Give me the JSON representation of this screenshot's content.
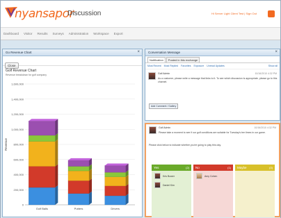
{
  "header": {
    "logo_text": "nyansapor",
    "app_title": "Discussion",
    "user_info": "Hi Server Light Client Test | Sign Out"
  },
  "nav": {
    "items": [
      "Dashboard",
      "Visitor",
      "Results",
      "Surveys",
      "Administration",
      "Workspace",
      "Export"
    ]
  },
  "left_panel": {
    "title": "Go Revenue Chart",
    "close_icon": "close-icon",
    "toolbar_button": "Close",
    "chart_title": "Golf Revenue Chart",
    "chart_subtitle": "Revenue breakdown for golf company"
  },
  "chart_data": {
    "type": "bar",
    "categories": [
      "Golf Balls",
      "Putters",
      "Drivers"
    ],
    "ylabel": "Revenue",
    "ylim": [
      0,
      1600000
    ],
    "yticks": [
      "1,600,000",
      "1,400,000",
      "1,200,000",
      "1,000,000",
      "800,000",
      "600,000",
      "400,000",
      "200,000",
      "0"
    ],
    "stacked": true,
    "series": [
      {
        "color": "#3b8fe0",
        "values": [
          230000,
          150000,
          120000
        ]
      },
      {
        "color": "#d23a2a",
        "values": [
          280000,
          170000,
          130000
        ]
      },
      {
        "color": "#f2b21c",
        "values": [
          330000,
          130000,
          120000
        ]
      },
      {
        "color": "#8ac83a",
        "values": [
          80000,
          60000,
          60000
        ]
      },
      {
        "color": "#9b4fb0",
        "values": [
          190000,
          80000,
          90000
        ]
      }
    ]
  },
  "right_top": {
    "title": "Conversation Message",
    "tabs": [
      "Notification",
      "Posted in this exchange"
    ],
    "subtabs": [
      "Most Recent",
      "Most Replied",
      "Favorites",
      "Exposure",
      "Unread Updates"
    ],
    "subtab_right": "Show all",
    "post_user": "Golf Admin",
    "post_time": "10/16/2010 4:32 PM",
    "post_text": "As a customer, please write a message that links to it. To see which discussion is appropriate, please go to this channel.",
    "reply_button": "Add Comment / Gallery"
  },
  "right_bottom": {
    "post_user": "Golf Admin",
    "post_time": "10/16/2010 4:32 PM",
    "post_text": "Please take a moment to see if our golf conditions are suitable for Tuesday's tee times in our game.",
    "question": "Please click below to indicate whether you're going to play this day.",
    "columns": [
      {
        "label": "Yes",
        "count": "(2)",
        "color": "#6aaa2a",
        "bg": "#e3f0d4",
        "members": [
          "Kris Bower",
          "Daniel Kim"
        ]
      },
      {
        "label": "No",
        "count": "(1)",
        "color": "#d23a2a",
        "bg": "#f6d8d6",
        "members": [
          "Amy Cohen"
        ]
      },
      {
        "label": "Maybe",
        "count": "(0)",
        "color": "#d8c02a",
        "bg": "#f5f0cc",
        "members": []
      }
    ]
  }
}
